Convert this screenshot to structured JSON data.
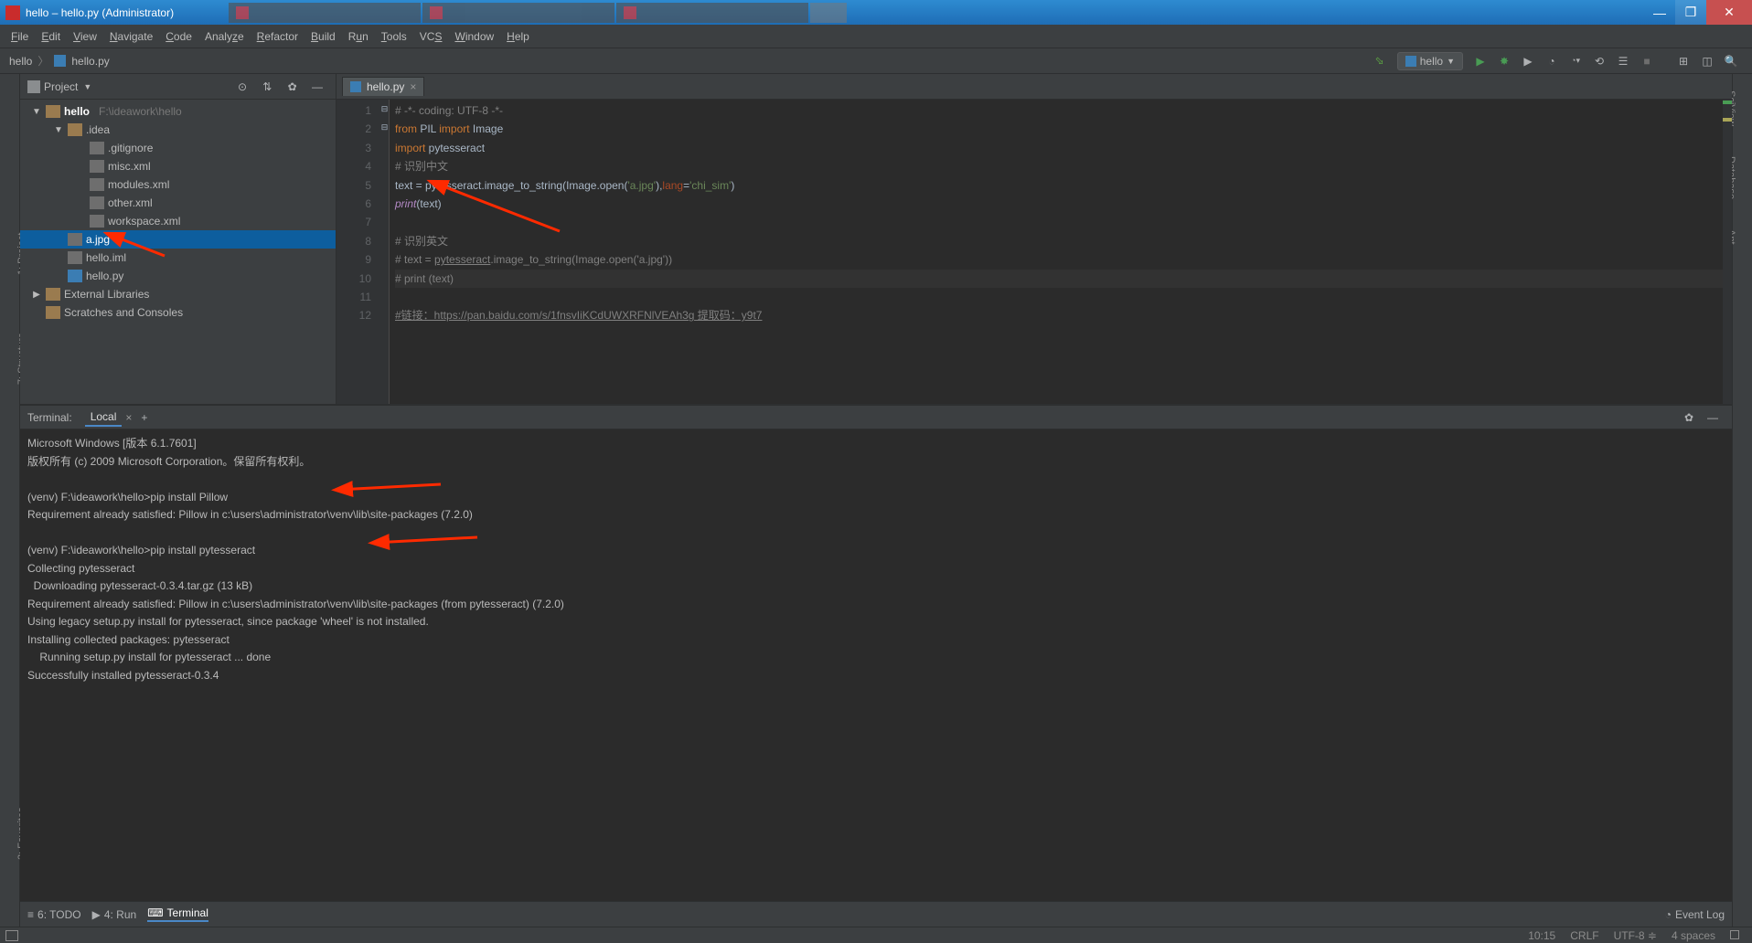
{
  "window": {
    "title": "hello – hello.py (Administrator)"
  },
  "menu": [
    "File",
    "Edit",
    "View",
    "Navigate",
    "Code",
    "Analyze",
    "Refactor",
    "Build",
    "Run",
    "Tools",
    "VCS",
    "Window",
    "Help"
  ],
  "breadcrumb": {
    "project": "hello",
    "file": "hello.py"
  },
  "run_config": {
    "label": "hello"
  },
  "project_panel": {
    "title": "Project",
    "tree": [
      {
        "depth": 0,
        "arrow": "▼",
        "type": "folder",
        "label": "hello",
        "hint": "F:\\ideawork\\hello",
        "bold": true
      },
      {
        "depth": 1,
        "arrow": "▼",
        "type": "folder",
        "label": ".idea"
      },
      {
        "depth": 2,
        "arrow": "",
        "type": "file",
        "label": ".gitignore"
      },
      {
        "depth": 2,
        "arrow": "",
        "type": "file",
        "label": "misc.xml"
      },
      {
        "depth": 2,
        "arrow": "",
        "type": "file",
        "label": "modules.xml"
      },
      {
        "depth": 2,
        "arrow": "",
        "type": "file",
        "label": "other.xml"
      },
      {
        "depth": 2,
        "arrow": "",
        "type": "file",
        "label": "workspace.xml"
      },
      {
        "depth": 1,
        "arrow": "",
        "type": "file",
        "label": "a.jpg",
        "selected": true
      },
      {
        "depth": 1,
        "arrow": "",
        "type": "file",
        "label": "hello.iml"
      },
      {
        "depth": 1,
        "arrow": "",
        "type": "py",
        "label": "hello.py"
      },
      {
        "depth": 0,
        "arrow": "▶",
        "type": "lib",
        "label": "External Libraries"
      },
      {
        "depth": 0,
        "arrow": "",
        "type": "scratch",
        "label": "Scratches and Consoles"
      }
    ]
  },
  "editor": {
    "tab": "hello.py",
    "lines": [
      {
        "n": 1,
        "raw": "# -*- coding: UTF-8 -*-",
        "cls": "cmt"
      },
      {
        "n": 2,
        "html": "<span class='kw'>from</span> PIL <span class='kw'>import</span> Image"
      },
      {
        "n": 3,
        "html": "<span class='kw'>import</span> pytesseract"
      },
      {
        "n": 4,
        "raw": "# 识别中文",
        "cls": "cmt"
      },
      {
        "n": 5,
        "html": "text = pytesseract.image_to_string(Image.open(<span class='str'>'a.jpg'</span>)<span class='cls'>,</span><span class='param'>lang</span>=<span class='str'>'chi_sim'</span>)"
      },
      {
        "n": 6,
        "html": "<span class='fn2'>print</span>(text)"
      },
      {
        "n": 7,
        "raw": ""
      },
      {
        "n": 8,
        "raw": "# 识别英文",
        "cls": "cmt"
      },
      {
        "n": 9,
        "html": "<span class='cmt'># text = <span class='und'>pytesseract</span>.image_to_string(Image.open('a.jpg'))</span>"
      },
      {
        "n": 10,
        "raw": "# print (text)",
        "cls": "cmt",
        "hl": true
      },
      {
        "n": 11,
        "raw": ""
      },
      {
        "n": 12,
        "html": "<span class='cmt'><span class='und'>#链接：https://pan.baidu.com/s/1fnsvIiKCdUWXRFNlVEAh3g 提取码：y9t7</span></span>"
      }
    ]
  },
  "terminal": {
    "header": "Terminal:",
    "tab": "Local",
    "lines": [
      "Microsoft Windows [版本 6.1.7601]",
      "版权所有 (c) 2009 Microsoft Corporation。保留所有权利。",
      "",
      "(venv) F:\\ideawork\\hello>pip install Pillow",
      "Requirement already satisfied: Pillow in c:\\users\\administrator\\venv\\lib\\site-packages (7.2.0)",
      "",
      "(venv) F:\\ideawork\\hello>pip install pytesseract",
      "Collecting pytesseract",
      "  Downloading pytesseract-0.3.4.tar.gz (13 kB)",
      "Requirement already satisfied: Pillow in c:\\users\\administrator\\venv\\lib\\site-packages (from pytesseract) (7.2.0)",
      "Using legacy setup.py install for pytesseract, since package 'wheel' is not installed.",
      "Installing collected packages: pytesseract",
      "    Running setup.py install for pytesseract ... done",
      "Successfully installed pytesseract-0.3.4"
    ]
  },
  "bottom_tools": {
    "todo": "6: TODO",
    "run": "4: Run",
    "terminal": "Terminal",
    "event_log": "Event Log"
  },
  "status": {
    "cursor": "10:15",
    "line_sep": "CRLF",
    "encoding": "UTF-8",
    "indent": "4 spaces"
  },
  "side_left": {
    "project": "1: Project",
    "structure": "7: Structure",
    "favorites": "2: Favorites"
  },
  "side_right": {
    "sciview": "SciView",
    "database": "Database",
    "ant": "Ant"
  }
}
